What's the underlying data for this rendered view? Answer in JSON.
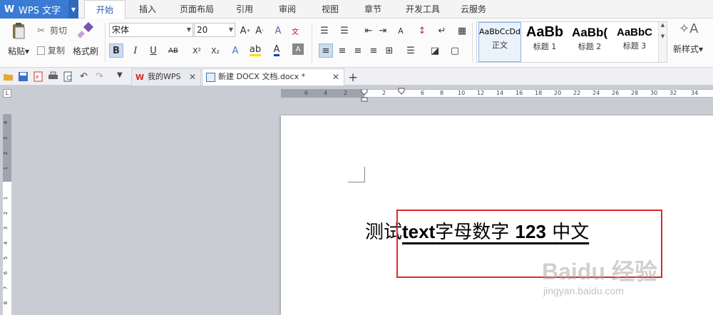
{
  "app": {
    "title": "WPS 文字",
    "logo": "W"
  },
  "menu": {
    "tabs": [
      "开始",
      "插入",
      "页面布局",
      "引用",
      "审阅",
      "视图",
      "章节",
      "开发工具",
      "云服务"
    ],
    "active": "开始"
  },
  "ribbon": {
    "paste_label": "粘贴",
    "cut_label": "剪切",
    "copy_label": "复制",
    "format_painter_label": "格式刷",
    "font_name": "宋体",
    "font_size": "20",
    "bold": "B",
    "italic": "I",
    "underline": "U",
    "strikethrough": "AB",
    "superscript": "X²",
    "subscript": "X₂",
    "new_style_label": "新样式",
    "styles": [
      {
        "preview": "AaBbCcDd",
        "label": "正文"
      },
      {
        "preview": "AaBb",
        "label": "标题 1"
      },
      {
        "preview": "AaBb(",
        "label": "标题 2"
      },
      {
        "preview": "AaBbC",
        "label": "标题 3"
      }
    ]
  },
  "doc_tabs": [
    {
      "label": "我的WPS",
      "active": false
    },
    {
      "label": "新建 DOCX 文档.docx *",
      "active": true
    }
  ],
  "ruler": {
    "h_numbers": [
      "6",
      "4",
      "2",
      "2",
      "6",
      "8",
      "10",
      "12",
      "14",
      "16",
      "18",
      "20",
      "22",
      "24",
      "26",
      "28",
      "30",
      "32",
      "34"
    ],
    "v_numbers": [
      "4",
      "3",
      "2",
      "1",
      "1",
      "2",
      "3",
      "4",
      "5",
      "6",
      "7",
      "8"
    ],
    "corner": "L"
  },
  "document": {
    "prefix": "测试",
    "latin1": "text",
    "cjk1": "字母数字",
    "latin2": "123",
    "cjk2": "中文"
  },
  "watermark": {
    "brand": "Baidu 经验",
    "url": "jingyan.baidu.com"
  },
  "colors": {
    "accent": "#3a7bd5",
    "highlight_box": "#e02727"
  }
}
